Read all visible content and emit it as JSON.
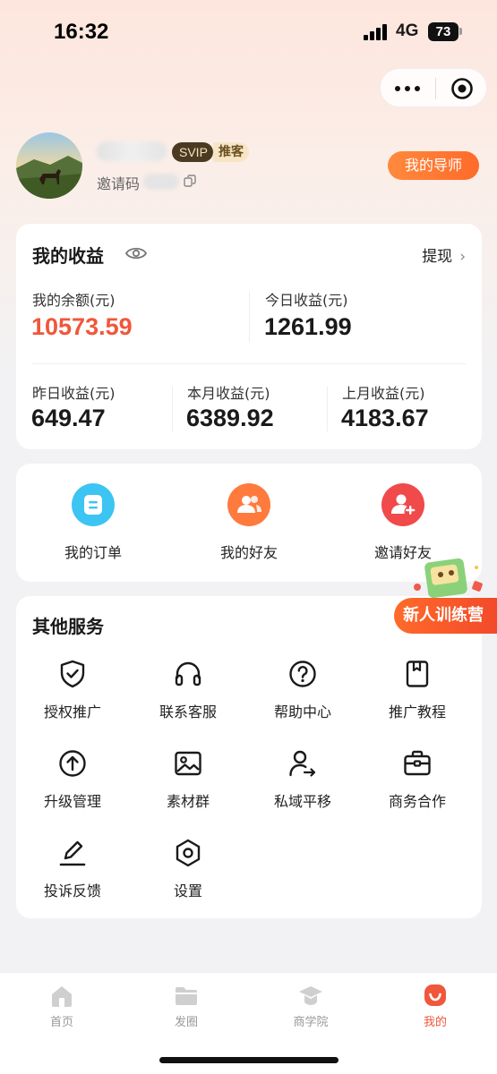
{
  "status_bar": {
    "time": "16:32",
    "network": "4G",
    "battery": "73"
  },
  "profile": {
    "badge_svip": "SVIP",
    "badge_role": "推客",
    "invite_label": "邀请码",
    "mentor_button": "我的导师"
  },
  "earnings": {
    "title": "我的收益",
    "withdraw": "提现",
    "balance_label": "我的余额(元)",
    "balance_value": "10573.59",
    "today_label": "今日收益(元)",
    "today_value": "1261.99",
    "yesterday_label": "昨日收益(元)",
    "yesterday_value": "649.47",
    "this_month_label": "本月收益(元)",
    "this_month_value": "6389.92",
    "last_month_label": "上月收益(元)",
    "last_month_value": "4183.67"
  },
  "quick_actions": [
    {
      "label": "我的订单",
      "icon": "order-icon",
      "color": "#3cc4f2"
    },
    {
      "label": "我的好友",
      "icon": "friends-icon",
      "color": "#ff7a3d"
    },
    {
      "label": "邀请好友",
      "icon": "invite-friend-icon",
      "color": "#f04a4a"
    }
  ],
  "promo": {
    "label": "新人训练营"
  },
  "services": {
    "title": "其他服务",
    "items": [
      {
        "label": "授权推广",
        "icon": "shield-check-icon"
      },
      {
        "label": "联系客服",
        "icon": "headphones-icon"
      },
      {
        "label": "帮助中心",
        "icon": "question-icon"
      },
      {
        "label": "推广教程",
        "icon": "bookmark-icon"
      },
      {
        "label": "升级管理",
        "icon": "upgrade-icon"
      },
      {
        "label": "素材群",
        "icon": "image-icon"
      },
      {
        "label": "私域平移",
        "icon": "user-transfer-icon"
      },
      {
        "label": "商务合作",
        "icon": "briefcase-icon"
      },
      {
        "label": "投诉反馈",
        "icon": "edit-icon"
      },
      {
        "label": "设置",
        "icon": "settings-icon"
      }
    ]
  },
  "tabbar": {
    "items": [
      {
        "label": "首页",
        "icon": "home-icon",
        "active": false
      },
      {
        "label": "发圈",
        "icon": "folder-icon",
        "active": false
      },
      {
        "label": "商学院",
        "icon": "graduation-cap-icon",
        "active": false
      },
      {
        "label": "我的",
        "icon": "profile-icon",
        "active": true
      }
    ]
  },
  "colors": {
    "accent": "#f0573b",
    "mentor_gradient": "#ff7a33"
  }
}
